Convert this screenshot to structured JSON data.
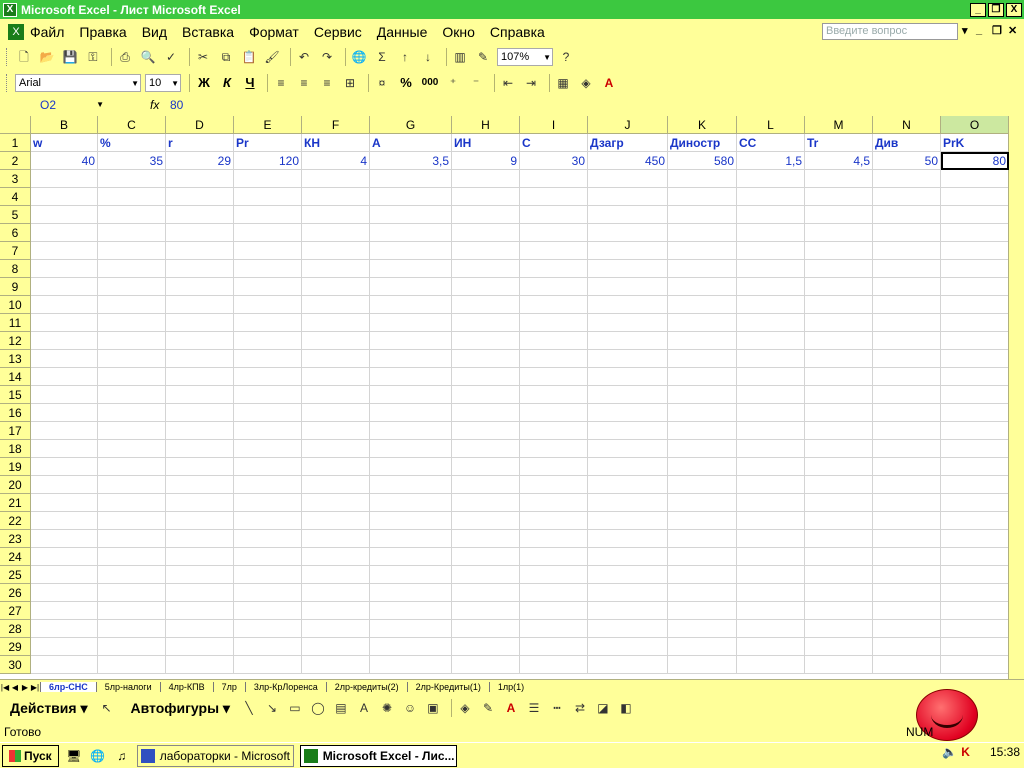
{
  "window": {
    "title": "Microsoft Excel - Лист Microsoft Excel",
    "min_label": "_",
    "max_label": "❐",
    "close_label": "X"
  },
  "menu": {
    "items": [
      "Файл",
      "Правка",
      "Вид",
      "Вставка",
      "Формат",
      "Сервис",
      "Данные",
      "Окно",
      "Справка"
    ],
    "help_placeholder": "Введите вопрос"
  },
  "toolbar": {
    "zoom": "107%",
    "font_name": "Arial",
    "font_size": "10",
    "bold_label": "Ж",
    "italic_label": "К",
    "underline_label": "Ч",
    "percent_label": "%",
    "thousands_label": "000"
  },
  "formula_bar": {
    "name_box": "O2",
    "fx_label": "fx",
    "value": "80"
  },
  "sheet": {
    "columns": [
      "B",
      "C",
      "D",
      "E",
      "F",
      "G",
      "H",
      "I",
      "J",
      "K",
      "L",
      "M",
      "N",
      "O"
    ],
    "active_column": "O",
    "rows": [
      "1",
      "2",
      "3",
      "4",
      "5",
      "6",
      "7",
      "8",
      "9",
      "10",
      "11",
      "12",
      "13",
      "14",
      "15",
      "16",
      "17",
      "18",
      "19",
      "20",
      "21",
      "22",
      "23",
      "24",
      "25",
      "26",
      "27",
      "28",
      "29",
      "30"
    ],
    "row1": [
      "w",
      "%",
      "r",
      "Pr",
      "КН",
      "A",
      "ИН",
      "C",
      "Дзагр",
      "Диностр",
      "CC",
      "Tr",
      "Див",
      "PrK"
    ],
    "row2": [
      "40",
      "35",
      "29",
      "120",
      "4",
      "3,5",
      "9",
      "30",
      "450",
      "580",
      "1,5",
      "4,5",
      "50",
      "80"
    ]
  },
  "tabs": [
    "6лр-СНС",
    "5лр-налоги",
    "4лр-КПВ",
    "7лр",
    "3лр-КрЛоренса",
    "2лр-кредиты(2)",
    "2лр-Кредиты(1)",
    "1лр(1)"
  ],
  "draw_toolbar": {
    "actions_label": "Действия",
    "autoshapes_label": "Автофигуры"
  },
  "status": {
    "ready": "Готово",
    "num": "NUM"
  },
  "taskbar": {
    "start": "Пуск",
    "items": [
      "лабораторки - Microsoft ...",
      "Microsoft Excel - Лис..."
    ],
    "clock": "15:38"
  },
  "colors": {
    "title_bg": "#3cc840",
    "chrome_bg": "#ffff99",
    "cell_text": "#1a36c8"
  }
}
